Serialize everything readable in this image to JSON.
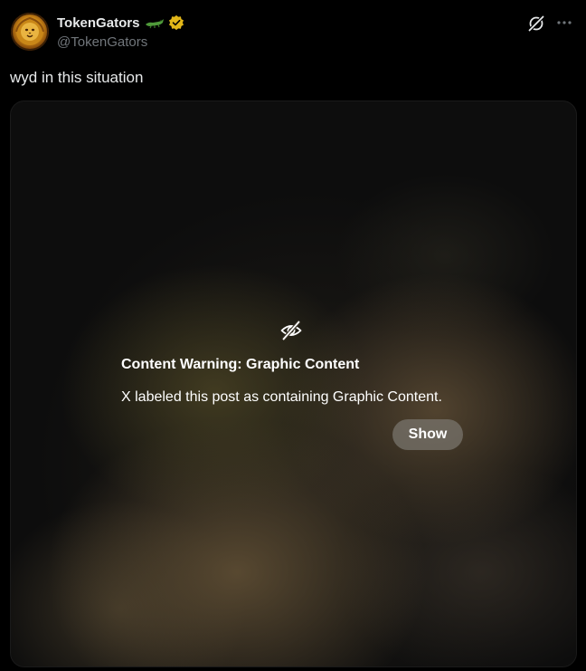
{
  "post": {
    "author": {
      "display_name": "TokenGators",
      "handle": "@TokenGators",
      "avatar": "golden-lion-medallion-avatar",
      "name_emoji": "crocodile-icon",
      "verified_badge": "verified-gold-badge-icon"
    },
    "actions": {
      "grok_icon": "grok-icon",
      "more_icon": "more-icon"
    },
    "text": "wyd in this situation",
    "media": {
      "icon": "eye-off-icon",
      "warning_title": "Content Warning: Graphic Content",
      "warning_body": "X labeled this post as containing Graphic Content.",
      "show_label": "Show"
    }
  },
  "colors": {
    "background": "#000000",
    "primary_text": "#e7e9ea",
    "secondary_text": "#71767b",
    "verified_gold": "#e2b719",
    "show_button_bg": "#78746c"
  }
}
